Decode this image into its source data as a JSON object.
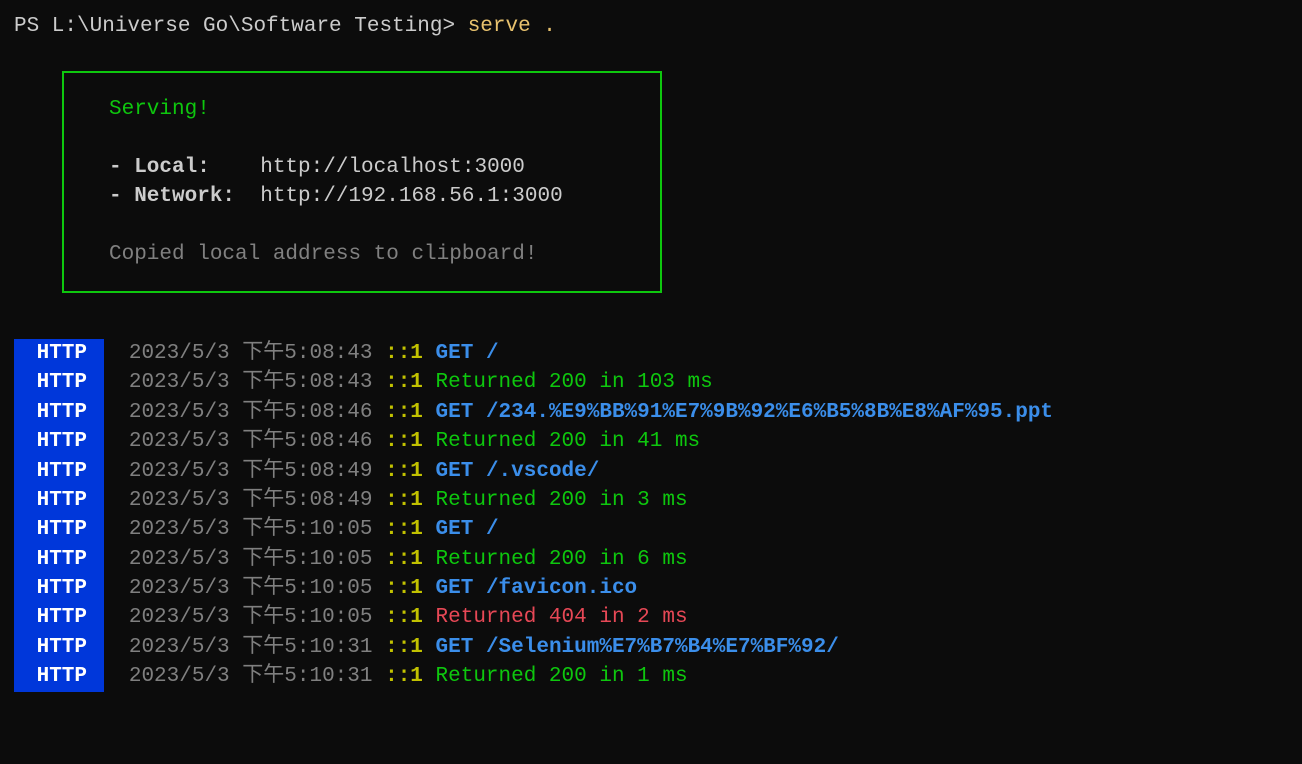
{
  "prompt": {
    "prefix": "PS L:\\Universe Go\\Software Testing> ",
    "command": "serve ."
  },
  "serving": {
    "title": "Serving!",
    "local_label": "- Local:   ",
    "local_url": " http://localhost:3000",
    "network_label": "- Network:",
    "network_url": "  http://192.168.56.1:3000",
    "copied": "Copied local address to clipboard!"
  },
  "logs": [
    {
      "badge": " HTTP ",
      "date": "2023/5/3 下午5:08:43",
      "ip": "::1",
      "method": "GET",
      "url": "/",
      "type": "request"
    },
    {
      "badge": " HTTP ",
      "date": "2023/5/3 下午5:08:43",
      "ip": "::1",
      "message": "Returned 200 in 103 ms",
      "type": "response_ok"
    },
    {
      "badge": " HTTP ",
      "date": "2023/5/3 下午5:08:46",
      "ip": "::1",
      "method": "GET",
      "url": "/234.%E9%BB%91%E7%9B%92%E6%B5%8B%E8%AF%95.ppt",
      "type": "request"
    },
    {
      "badge": " HTTP ",
      "date": "2023/5/3 下午5:08:46",
      "ip": "::1",
      "message": "Returned 200 in 41 ms",
      "type": "response_ok"
    },
    {
      "badge": " HTTP ",
      "date": "2023/5/3 下午5:08:49",
      "ip": "::1",
      "method": "GET",
      "url": "/.vscode/",
      "type": "request"
    },
    {
      "badge": " HTTP ",
      "date": "2023/5/3 下午5:08:49",
      "ip": "::1",
      "message": "Returned 200 in 3 ms",
      "type": "response_ok"
    },
    {
      "badge": " HTTP ",
      "date": "2023/5/3 下午5:10:05",
      "ip": "::1",
      "method": "GET",
      "url": "/",
      "type": "request"
    },
    {
      "badge": " HTTP ",
      "date": "2023/5/3 下午5:10:05",
      "ip": "::1",
      "message": "Returned 200 in 6 ms",
      "type": "response_ok"
    },
    {
      "badge": " HTTP ",
      "date": "2023/5/3 下午5:10:05",
      "ip": "::1",
      "method": "GET",
      "url": "/favicon.ico",
      "type": "request"
    },
    {
      "badge": " HTTP ",
      "date": "2023/5/3 下午5:10:05",
      "ip": "::1",
      "message": "Returned 404 in 2 ms",
      "type": "response_err"
    },
    {
      "badge": " HTTP ",
      "date": "2023/5/3 下午5:10:31",
      "ip": "::1",
      "method": "GET",
      "url": "/Selenium%E7%B7%B4%E7%BF%92/",
      "type": "request"
    },
    {
      "badge": " HTTP ",
      "date": "2023/5/3 下午5:10:31",
      "ip": "::1",
      "message": "Returned 200 in 1 ms",
      "type": "response_ok"
    }
  ]
}
